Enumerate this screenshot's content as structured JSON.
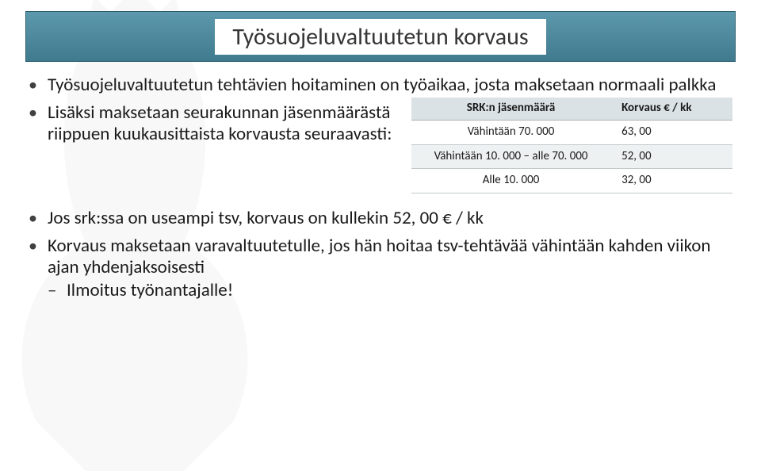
{
  "title": "Työsuojeluvaltuutetun korvaus",
  "bullets": {
    "b1": "Työsuojeluvaltuutetun tehtävien hoitaminen on työaikaa, josta maksetaan normaali palkka",
    "b2": "Lisäksi maksetaan seurakunnan jäsenmäärästä riippuen kuukausittaista korvausta seuraavasti:",
    "b3": "Jos srk:ssa on useampi tsv, korvaus on kullekin 52, 00 € / kk",
    "b4": "Korvaus maksetaan varavaltuutetulle, jos hän hoitaa tsv-tehtävää vähintään kahden viikon ajan yhdenjaksoisesti",
    "b4_sub1": "Ilmoitus työnantajalle!"
  },
  "table": {
    "headers": {
      "col1": "SRK:n jäsenmäärä",
      "col2": "Korvaus € / kk"
    },
    "rows": [
      {
        "tier": "Vähintään 70. 000",
        "amount": "63, 00"
      },
      {
        "tier": "Vähintään 10. 000 – alle 70. 000",
        "amount": "52, 00"
      },
      {
        "tier": "Alle 10. 000",
        "amount": "32, 00"
      }
    ]
  },
  "chart_data": {
    "type": "table",
    "title": "Työsuojeluvaltuutetun korvaus",
    "columns": [
      "SRK:n jäsenmäärä",
      "Korvaus € / kk"
    ],
    "rows": [
      [
        "Vähintään 70. 000",
        "63, 00"
      ],
      [
        "Vähintään 10. 000 – alle 70. 000",
        "52, 00"
      ],
      [
        "Alle 10. 000",
        "32, 00"
      ]
    ]
  }
}
